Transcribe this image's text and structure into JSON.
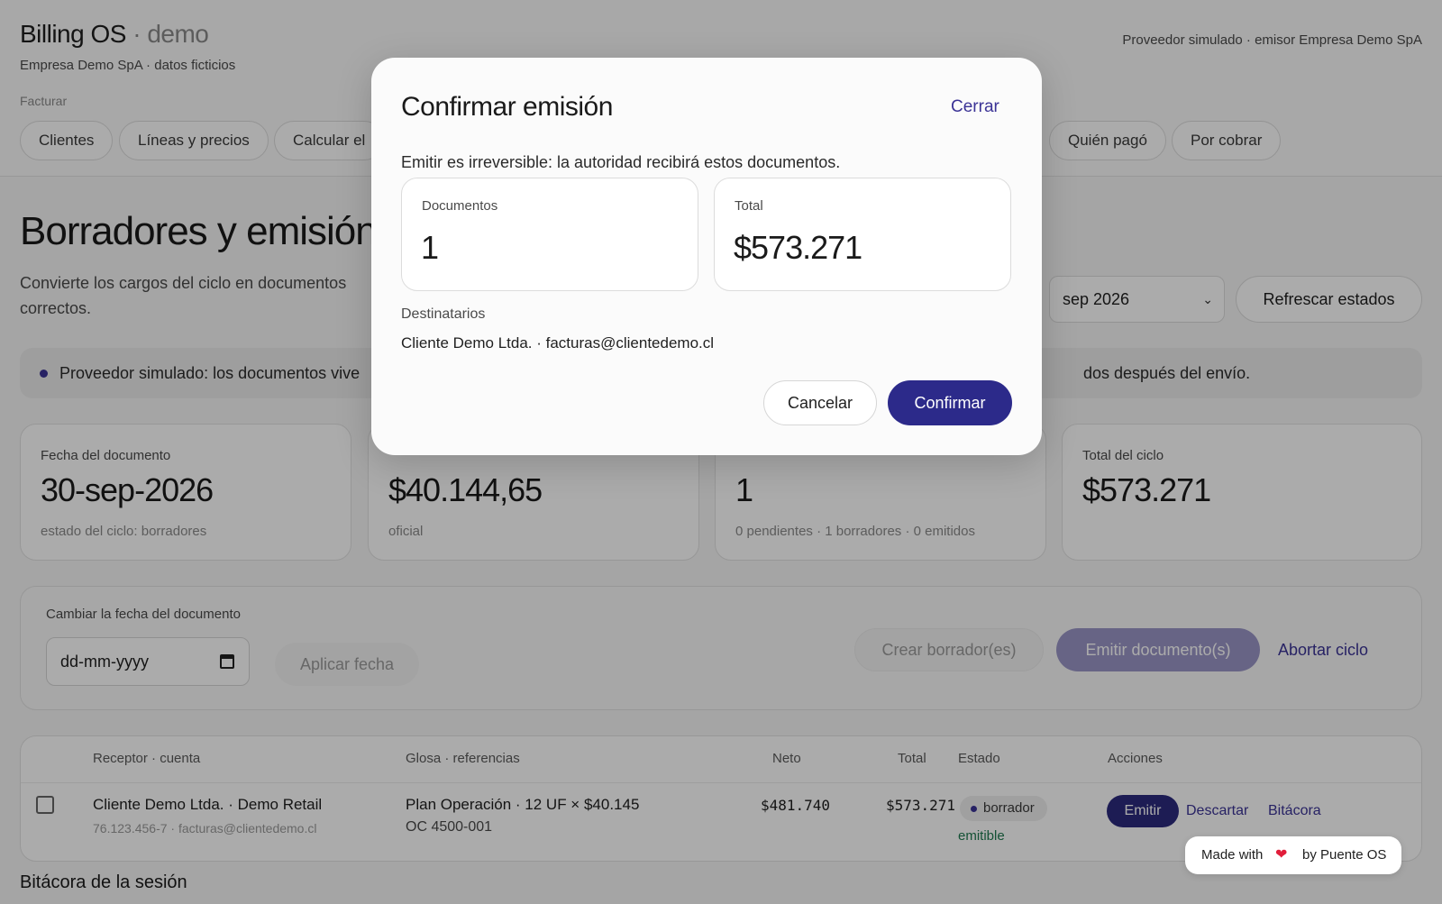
{
  "app": {
    "name": "Billing OS",
    "separator": " · ",
    "env": "demo",
    "subtitle": "Empresa Demo SpA · datos ficticios",
    "provider": "Proveedor simulado · emisor Empresa Demo SpA"
  },
  "nav": {
    "section_label": "Facturar",
    "tabs": [
      {
        "label": "Clientes"
      },
      {
        "label": "Líneas y precios"
      },
      {
        "label": "Calcular el"
      },
      {
        "label": "Quién pagó"
      },
      {
        "label": "Por cobrar"
      }
    ]
  },
  "main": {
    "title": "Borradores y emisión",
    "lede": "Convierte los cargos del ciclo en documentos correctos.",
    "period_select": "sep 2026",
    "refresh_button": "Refrescar estados",
    "notice_left": "Proveedor simulado: los documentos vive",
    "notice_right": "dos después del envío.",
    "stats": [
      {
        "label": "Fecha del documento",
        "value": "30-sep-2026",
        "sub": "estado del ciclo: borradores"
      },
      {
        "label": "",
        "value": "$40.144,65",
        "sub": "oficial"
      },
      {
        "label": "",
        "value": "1",
        "sub": "0 pendientes · 1 borradores · 0 emitidos"
      },
      {
        "label": "Total del ciclo",
        "value": "$573.271",
        "sub": ""
      }
    ],
    "date_panel": {
      "label": "Cambiar la fecha del documento",
      "placeholder": "dd-mm-yyyy",
      "apply_button": "Aplicar fecha",
      "create_button": "Crear borrador(es)",
      "emit_button": "Emitir documento(s)",
      "abort_link": "Abortar ciclo"
    },
    "table": {
      "headers": {
        "receptor": "Receptor · cuenta",
        "glosa": "Glosa · referencias",
        "neto": "Neto",
        "total": "Total",
        "estado": "Estado",
        "acciones": "Acciones"
      },
      "rows": [
        {
          "receptor": "Cliente Demo Ltda. · Demo Retail",
          "receptor_sub": "76.123.456-7 · facturas@clientedemo.cl",
          "glosa": "Plan Operación · 12 UF × $40.145",
          "glosa_sub": "OC 4500-001",
          "neto": "$481.740",
          "total": "$573.271",
          "estado": "borrador",
          "estado_sub": "emitible",
          "action_emit": "Emitir",
          "action_discard": "Descartar",
          "action_log": "Bitácora"
        }
      ]
    },
    "bottom_heading": "Bitácora de la sesión"
  },
  "modal": {
    "title": "Confirmar emisión",
    "close": "Cerrar",
    "warning": "Emitir es irreversible: la autoridad recibirá estos documentos.",
    "cards": [
      {
        "label": "Documentos",
        "value": "1"
      },
      {
        "label": "Total",
        "value": "$573.271"
      }
    ],
    "recipients_label": "Destinatarios",
    "recipients": "Cliente Demo Ltda. · facturas@clientedemo.cl",
    "cancel": "Cancelar",
    "confirm": "Confirmar"
  },
  "made_with": {
    "prefix": "Made with",
    "suffix": "by Puente OS",
    "heart_icon": "heart-icon"
  },
  "colors": {
    "accent": "#2c2a8a",
    "link": "#3b3396",
    "success": "#1f7a4f"
  }
}
